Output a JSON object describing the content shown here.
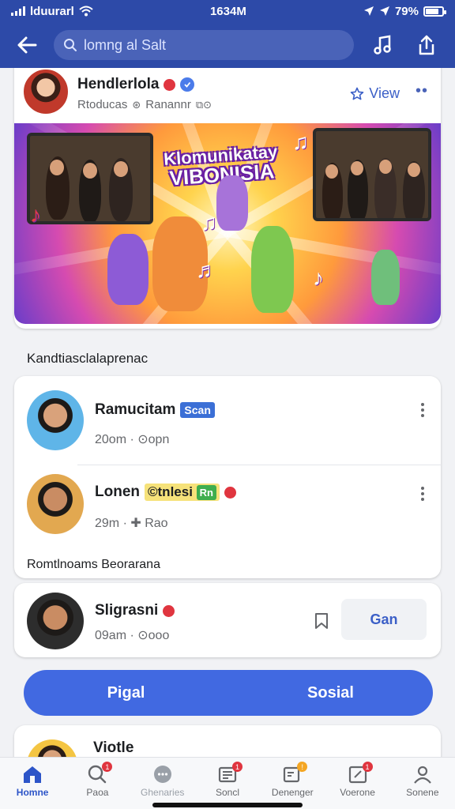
{
  "status_bar": {
    "carrier": "lduurarl",
    "time": "1634M",
    "battery": "79%",
    "battery_level": 0.79
  },
  "header": {
    "search_placeholder": "lomng al Salt",
    "icons": [
      "back-arrow-icon",
      "music-note-icon",
      "share-upload-icon"
    ]
  },
  "post": {
    "author": "Hendlerlola",
    "meta": "Rtoducas",
    "meta_extra": "Ranannr",
    "view_label": "View",
    "banner_title_line1": "Klomunikatay",
    "banner_title_line2": "VIBONISIA"
  },
  "section1": {
    "label": "Kandtiasclalaprenac",
    "people": [
      {
        "name": "Ramucitam",
        "tag": "Scan",
        "meta": "20om · ⊙opn"
      },
      {
        "name": "Lonen",
        "tag": "©tnlesi",
        "tag2": "Rn",
        "meta": "29m · ✚ Rao"
      }
    ],
    "footer": "Romtlnoams Beorarana"
  },
  "suggest": {
    "name": "Sligrasni",
    "meta": "09am · ⊙ooo",
    "button": "Gan"
  },
  "split_button": {
    "left": "Pigal",
    "right": "Sosial"
  },
  "last_card": {
    "name": "Viotle"
  },
  "tabs": [
    {
      "label": "Homne",
      "icon": "home-icon",
      "active": true
    },
    {
      "label": "Paoa",
      "icon": "search-icon",
      "badge": true
    },
    {
      "label": "Ghenaries",
      "icon": "chat-bubble-icon"
    },
    {
      "label": "Soncl",
      "icon": "news-icon",
      "badge": true
    },
    {
      "label": "Denenger",
      "icon": "message-edit-icon",
      "badge": true
    },
    {
      "label": "Voerone",
      "icon": "compose-icon",
      "badge": true
    },
    {
      "label": "Sonene",
      "icon": "profile-icon"
    }
  ],
  "colors": {
    "brand": "#2d4aa8",
    "accent": "#4169e1",
    "badge": "#e0353f"
  }
}
